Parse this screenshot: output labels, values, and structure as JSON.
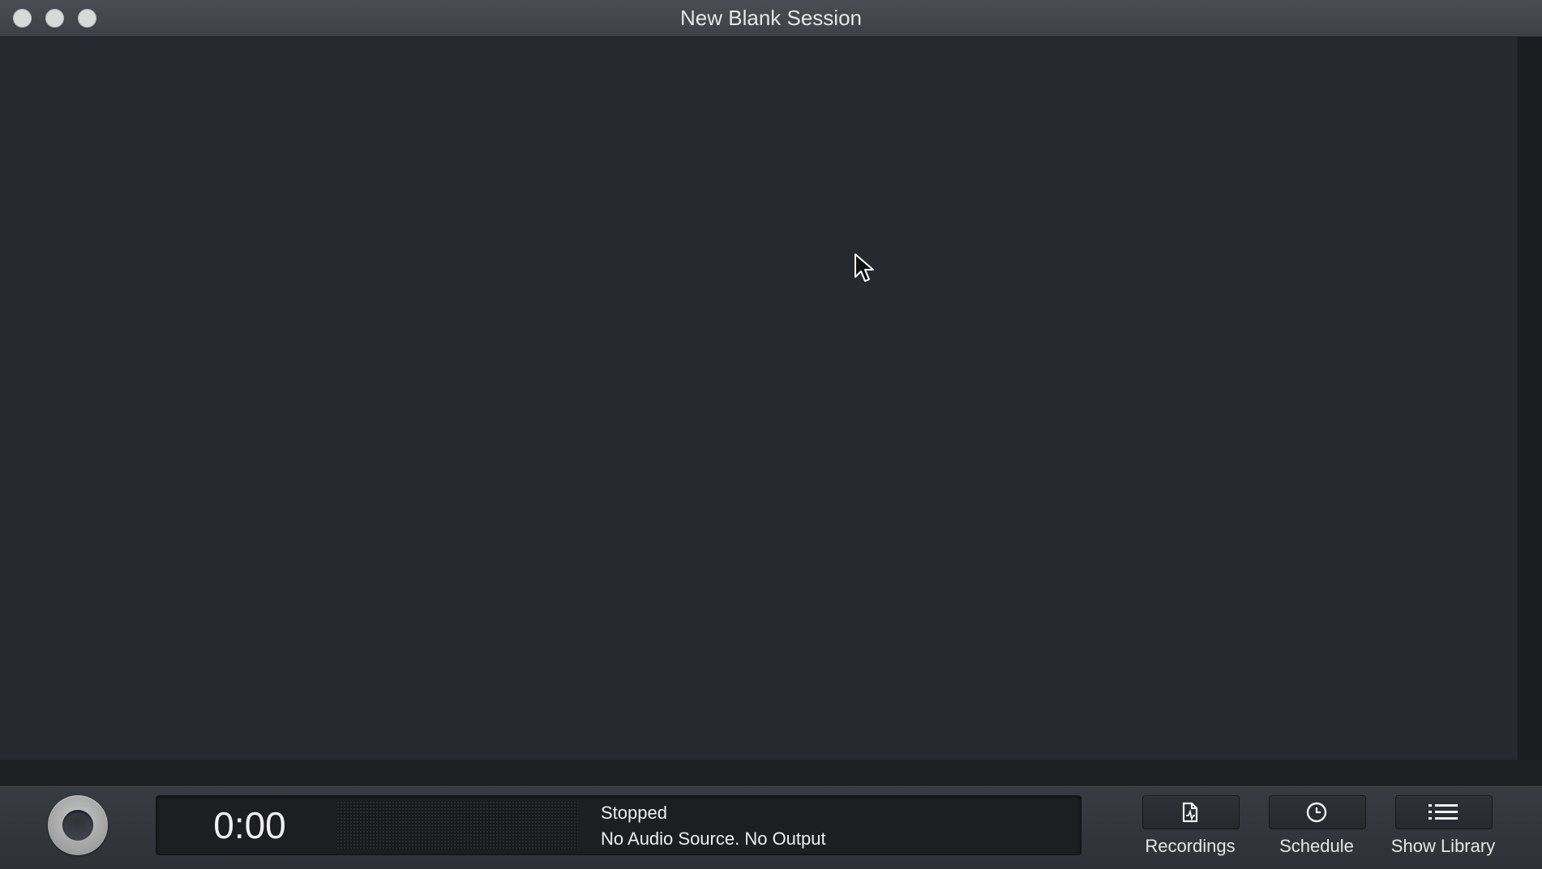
{
  "window": {
    "title": "New Blank Session"
  },
  "transport": {
    "time": "0:00",
    "status": "Stopped",
    "source_info": "No Audio Source. No Output"
  },
  "toolbar": {
    "recordings_label": "Recordings",
    "recordings_icon": "recordings-document-icon",
    "schedule_label": "Schedule",
    "schedule_icon": "clock-icon",
    "library_label": "Show Library",
    "library_icon": "list-icon"
  },
  "colors": {
    "canvas": "#26292e",
    "titlebar": "#3d4046",
    "text": "#e6e6e6"
  }
}
